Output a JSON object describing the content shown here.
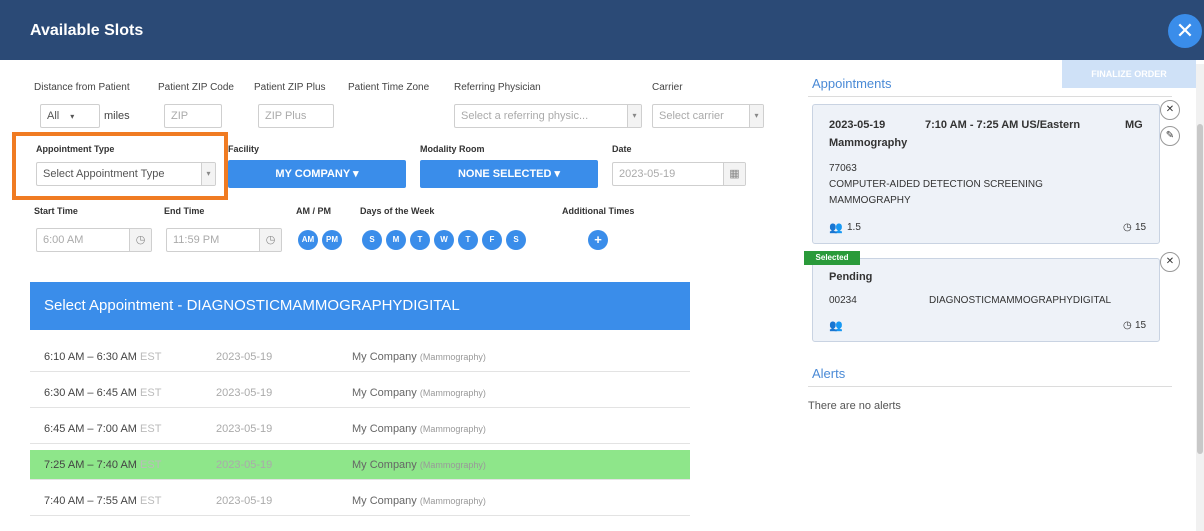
{
  "window": {
    "title": "Available Slots",
    "close_glyph": "✕"
  },
  "filters": {
    "distance_label": "Distance from Patient",
    "distance_value": "All",
    "miles_label": "miles",
    "zip_code_label": "Patient ZIP Code",
    "zip_code_value": "ZIP",
    "zip_plus_label": "Patient ZIP Plus",
    "zip_plus_placeholder": "ZIP Plus",
    "time_zone_label": "Patient Time Zone",
    "referring_physician_label": "Referring Physician",
    "referring_physician_placeholder": "Select a referring physic...",
    "carrier_label": "Carrier",
    "carrier_placeholder": "Select carrier",
    "appointment_type_label": "Appointment Type",
    "appointment_type_value": "Select Appointment Type",
    "facility_label": "Facility",
    "facility_value": "MY COMPANY ▾",
    "modality_label": "Modality Room",
    "modality_value": "NONE SELECTED ▾",
    "date_label": "Date",
    "date_value": "2023-05-19",
    "start_time_label": "Start Time",
    "start_time_value": "6:00 AM",
    "end_time_label": "End Time",
    "end_time_value": "11:59 PM",
    "ampm_label": "AM / PM",
    "ampm": [
      "AM",
      "PM"
    ],
    "days_label": "Days of the Week",
    "days": [
      "S",
      "M",
      "T",
      "W",
      "T",
      "F",
      "S"
    ],
    "additional_times_label": "Additional Times",
    "additional_times_glyph": "+"
  },
  "slots": {
    "header": "Select Appointment - DIAGNOSTICMAMMOGRAPHYDIGITAL",
    "rows": [
      {
        "time": "6:10 AM – 6:30 AM",
        "tz": "EST",
        "date": "2023-05-19",
        "company": "My Company",
        "room": "(Mammography)",
        "selected": false
      },
      {
        "time": "6:30 AM – 6:45 AM",
        "tz": "EST",
        "date": "2023-05-19",
        "company": "My Company",
        "room": "(Mammography)",
        "selected": false
      },
      {
        "time": "6:45 AM – 7:00 AM",
        "tz": "EST",
        "date": "2023-05-19",
        "company": "My Company",
        "room": "(Mammography)",
        "selected": false
      },
      {
        "time": "7:25 AM – 7:40 AM",
        "tz": "EST",
        "date": "2023-05-19",
        "company": "My Company",
        "room": "(Mammography)",
        "selected": true
      },
      {
        "time": "7:40 AM – 7:55 AM",
        "tz": "EST",
        "date": "2023-05-19",
        "company": "My Company",
        "room": "(Mammography)",
        "selected": false
      }
    ]
  },
  "right_panel": {
    "button_label": "FINALIZE ORDER",
    "appointments_title": "Appointments",
    "appt1": {
      "date": "2023-05-19",
      "time": "7:10 AM - 7:25 AM US/Eastern",
      "room": "MG",
      "modality": "Mammography",
      "code": "77063",
      "desc_line1": "COMPUTER-AIDED DETECTION SCREENING",
      "desc_line2": "MAMMOGRAPHY",
      "people": "1.5",
      "minutes": "15"
    },
    "selected_badge": "Selected",
    "appt2": {
      "status": "Pending",
      "code": "00234",
      "desc": "DIAGNOSTICMAMMOGRAPHYDIGITAL",
      "minutes": "15"
    },
    "alerts_title": "Alerts",
    "alerts_text": "There are no alerts"
  }
}
